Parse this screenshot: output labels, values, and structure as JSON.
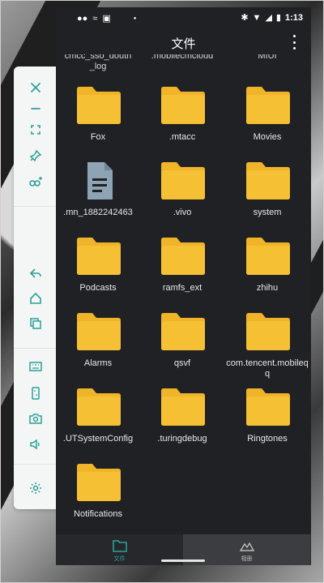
{
  "statusbar": {
    "time": "1:13"
  },
  "appbar": {
    "title": "文件"
  },
  "partial_labels": [
    "cmcc_sso_douth\n_log",
    ".mobilecmcloud",
    "MIUI"
  ],
  "files": [
    {
      "label": "Fox",
      "kind": "folder"
    },
    {
      "label": ".mtacc",
      "kind": "folder"
    },
    {
      "label": "Movies",
      "kind": "folder"
    },
    {
      "label": ".mn_1882242463",
      "kind": "file"
    },
    {
      "label": ".vivo",
      "kind": "folder"
    },
    {
      "label": "system",
      "kind": "folder"
    },
    {
      "label": "Podcasts",
      "kind": "folder"
    },
    {
      "label": "ramfs_ext",
      "kind": "folder"
    },
    {
      "label": "zhihu",
      "kind": "folder"
    },
    {
      "label": "Alarms",
      "kind": "folder"
    },
    {
      "label": "qsvf",
      "kind": "folder"
    },
    {
      "label": "com.tencent.mobileqq",
      "kind": "folder"
    },
    {
      "label": ".UTSystemConfig",
      "kind": "folder"
    },
    {
      "label": ".turingdebug",
      "kind": "folder"
    },
    {
      "label": "Ringtones",
      "kind": "folder"
    },
    {
      "label": "Notifications",
      "kind": "folder"
    }
  ],
  "bottomnav": {
    "tabs": [
      {
        "label": "文件",
        "icon": "folder-icon",
        "active": true
      },
      {
        "label": "相册",
        "icon": "mountain-icon",
        "active": false
      }
    ]
  },
  "toolbar": {
    "tools": [
      "close-icon",
      "minimize-icon",
      "fullscreen-icon",
      "pin-icon",
      "infinity-plus-icon",
      "back-icon",
      "home-icon",
      "recents-icon",
      "keyboard-icon",
      "screenshot-icon",
      "camera-icon",
      "volume-icon",
      "settings-icon"
    ]
  },
  "colors": {
    "folder": "#f5c034",
    "folder_tab": "#f0b429",
    "file_doc": "#8ea3b3",
    "accent": "#2aa198",
    "bg": "#202124"
  }
}
